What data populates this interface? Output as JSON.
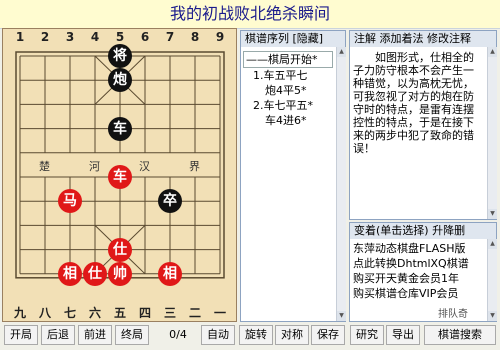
{
  "title": "我的初战败北绝杀瞬间",
  "board": {
    "files_top": [
      "1",
      "2",
      "3",
      "4",
      "5",
      "6",
      "7",
      "8",
      "9"
    ],
    "files_bottom": [
      "九",
      "八",
      "七",
      "六",
      "五",
      "四",
      "三",
      "二",
      "一"
    ],
    "river": [
      "楚",
      "河",
      "汉",
      "界"
    ],
    "pieces": [
      {
        "name": "black-general",
        "label": "将",
        "color": "black",
        "file": 4,
        "rank": 0
      },
      {
        "name": "black-cannon",
        "label": "炮",
        "color": "black",
        "file": 4,
        "rank": 1
      },
      {
        "name": "black-chariot",
        "label": "车",
        "color": "black",
        "file": 4,
        "rank": 3
      },
      {
        "name": "black-soldier",
        "label": "卒",
        "color": "black",
        "file": 6,
        "rank": 6
      },
      {
        "name": "red-chariot",
        "label": "车",
        "color": "red",
        "file": 4,
        "rank": 5
      },
      {
        "name": "red-horse",
        "label": "马",
        "color": "red",
        "file": 2,
        "rank": 6
      },
      {
        "name": "red-advisor-center",
        "label": "仕",
        "color": "red",
        "file": 4,
        "rank": 8
      },
      {
        "name": "red-elephant-left",
        "label": "相",
        "color": "red",
        "file": 2,
        "rank": 9
      },
      {
        "name": "red-advisor-left",
        "label": "仕",
        "color": "red",
        "file": 3,
        "rank": 9
      },
      {
        "name": "red-king",
        "label": "帅",
        "color": "red",
        "file": 4,
        "rank": 9
      },
      {
        "name": "red-elephant-right",
        "label": "相",
        "color": "red",
        "file": 6,
        "rank": 9
      }
    ]
  },
  "movelist": {
    "header": "棋谱序列  [隐藏]",
    "items": [
      "——棋局开始*",
      "1.车五平七",
      "炮4平5*",
      "2.车七平五*",
      "车4进6*"
    ]
  },
  "annotation": {
    "header": "注解  添加着法  修改注释",
    "text": "如图形式，仕相全的子力防守根本不会产生一种错觉，以为高枕无忧，可我忽视了对方的炮在防守时的特点，是雷有连摆控性的特点，于是在接下来的两步中犯了致命的错误！"
  },
  "variations": {
    "header": "变着(单击选择)  升降删",
    "items": [
      "东萍动态棋盘FLASH版",
      "点此转换DhtmlXQ棋谱",
      "购买开天黄金会员1年",
      "购买棋谱仓库VIP会员"
    ]
  },
  "toolbar": {
    "buttons": [
      "开局",
      "后退",
      "前进",
      "终局",
      "自动",
      "旋转",
      "对称",
      "保存",
      "研究",
      "导出",
      "棋谱搜索"
    ],
    "counter": "0/4"
  },
  "watermark": "排队奇"
}
